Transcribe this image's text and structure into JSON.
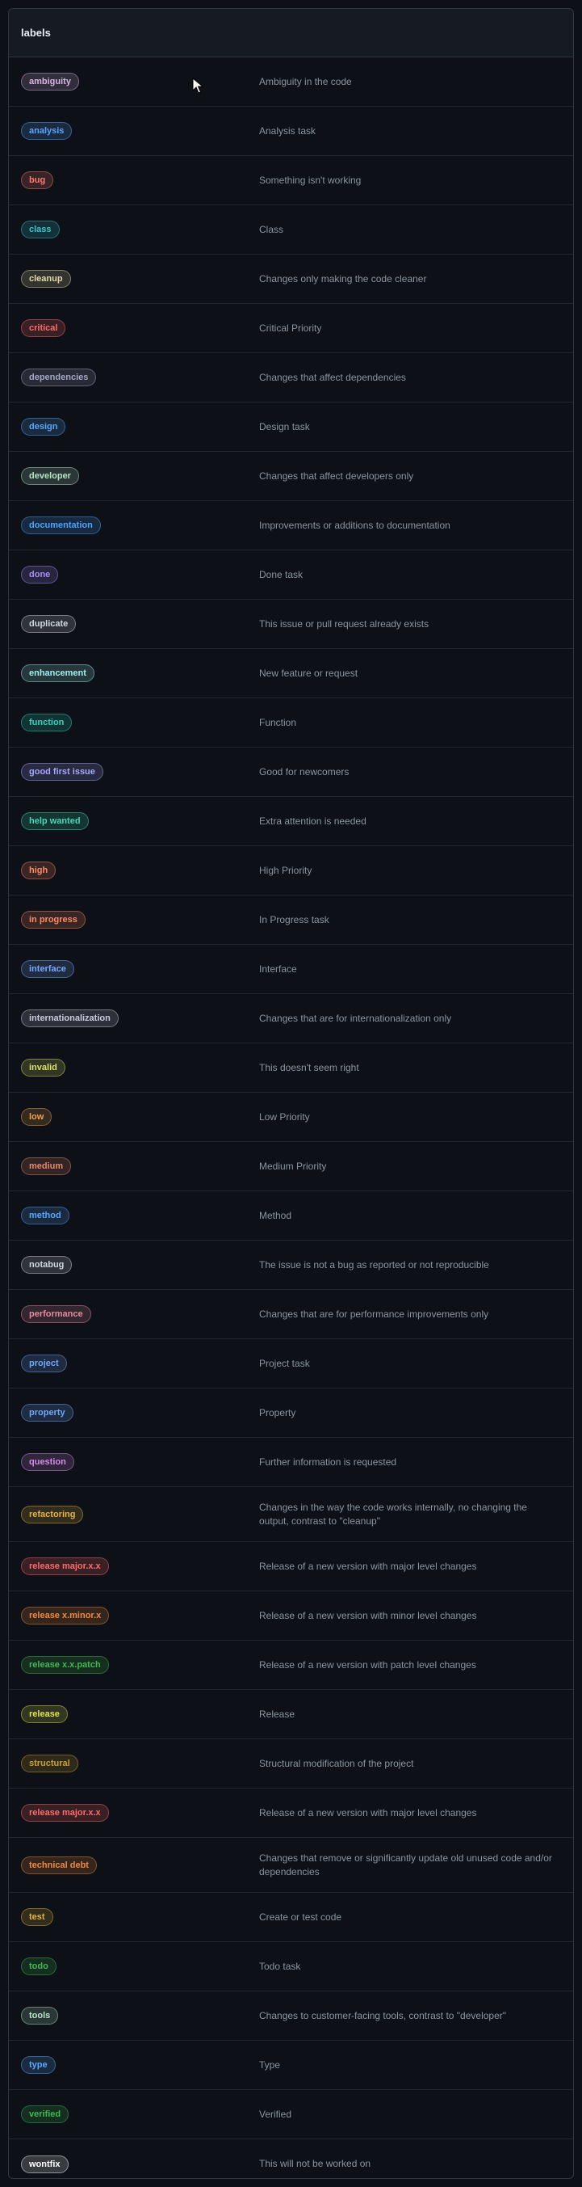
{
  "header": {
    "title": "labels"
  },
  "labels": [
    {
      "name": "ambiguity",
      "description": "Ambiguity in the code",
      "color": "#d8b4e2"
    },
    {
      "name": "analysis",
      "description": "Analysis task",
      "color": "#58a6ff"
    },
    {
      "name": "bug",
      "description": "Something isn't working",
      "color": "#ff7b72"
    },
    {
      "name": "class",
      "description": "Class",
      "color": "#39c5cf"
    },
    {
      "name": "cleanup",
      "description": "Changes only making the code cleaner",
      "color": "#e3d9a5"
    },
    {
      "name": "critical",
      "description": "Critical Priority",
      "color": "#ff6b6b"
    },
    {
      "name": "dependencies",
      "description": "Changes that affect dependencies",
      "color": "#a5a5c8"
    },
    {
      "name": "design",
      "description": "Design task",
      "color": "#58a6ff"
    },
    {
      "name": "developer",
      "description": "Changes that affect developers only",
      "color": "#b7e4c7"
    },
    {
      "name": "documentation",
      "description": "Improvements or additions to documentation",
      "color": "#4aa3ff"
    },
    {
      "name": "done",
      "description": "Done task",
      "color": "#a78bfa"
    },
    {
      "name": "duplicate",
      "description": "This issue or pull request already exists",
      "color": "#d0d7de"
    },
    {
      "name": "enhancement",
      "description": "New feature or request",
      "color": "#a2eeef"
    },
    {
      "name": "function",
      "description": "Function",
      "color": "#2dd4bf"
    },
    {
      "name": "good first issue",
      "description": "Good for newcomers",
      "color": "#a5a8ff"
    },
    {
      "name": "help wanted",
      "description": "Extra attention is needed",
      "color": "#3fdbb5"
    },
    {
      "name": "high",
      "description": "High Priority",
      "color": "#ff8a65"
    },
    {
      "name": "in progress",
      "description": "In Progress task",
      "color": "#ff8a65"
    },
    {
      "name": "interface",
      "description": "Interface",
      "color": "#79a8ff"
    },
    {
      "name": "internationalization",
      "description": "Changes that are for internationalization only",
      "color": "#c9c9e0"
    },
    {
      "name": "invalid",
      "description": "This doesn't seem right",
      "color": "#d9e36a"
    },
    {
      "name": "low",
      "description": "Low Priority",
      "color": "#f0a04b"
    },
    {
      "name": "medium",
      "description": "Medium Priority",
      "color": "#e5876b"
    },
    {
      "name": "method",
      "description": "Method",
      "color": "#58a6ff"
    },
    {
      "name": "notabug",
      "description": "The issue is not a bug as reported or not reproducible",
      "color": "#d0d7de"
    },
    {
      "name": "performance",
      "description": "Changes that are for performance improvements only",
      "color": "#e58ba0"
    },
    {
      "name": "project",
      "description": "Project task",
      "color": "#6ea8fe"
    },
    {
      "name": "property",
      "description": "Property",
      "color": "#6ea8fe"
    },
    {
      "name": "question",
      "description": "Further information is requested",
      "color": "#d58be8"
    },
    {
      "name": "refactoring",
      "description": "Changes in the way the code works internally, no changing the output, contrast to \"cleanup\"",
      "color": "#e3b341"
    },
    {
      "name": "release major.x.x",
      "description": "Release of a new version with major level changes",
      "color": "#ff6b6b"
    },
    {
      "name": "release x.minor.x",
      "description": "Release of a new version with minor level changes",
      "color": "#f0883e"
    },
    {
      "name": "release x.x.patch",
      "description": "Release of a new version with patch level changes",
      "color": "#3fb950"
    },
    {
      "name": "release",
      "description": "Release",
      "color": "#e3e34b"
    },
    {
      "name": "structural",
      "description": "Structural modification of the project",
      "color": "#c9a227"
    },
    {
      "name": "release major.x.x",
      "description": "Release of a new version with major level changes",
      "color": "#ff6b6b"
    },
    {
      "name": "technical debt",
      "description": "Changes that remove or significantly update old unused code and/or dependencies",
      "color": "#f0883e"
    },
    {
      "name": "test",
      "description": "Create or test code",
      "color": "#e3b341"
    },
    {
      "name": "todo",
      "description": "Todo task",
      "color": "#3fb950"
    },
    {
      "name": "tools",
      "description": "Changes to customer-facing tools, contrast to \"developer\"",
      "color": "#b7e4c7"
    },
    {
      "name": "type",
      "description": "Type",
      "color": "#58a6ff"
    },
    {
      "name": "verified",
      "description": "Verified",
      "color": "#3fb950"
    },
    {
      "name": "wontfix",
      "description": "This will not be worked on",
      "color": "#ffffff"
    }
  ]
}
